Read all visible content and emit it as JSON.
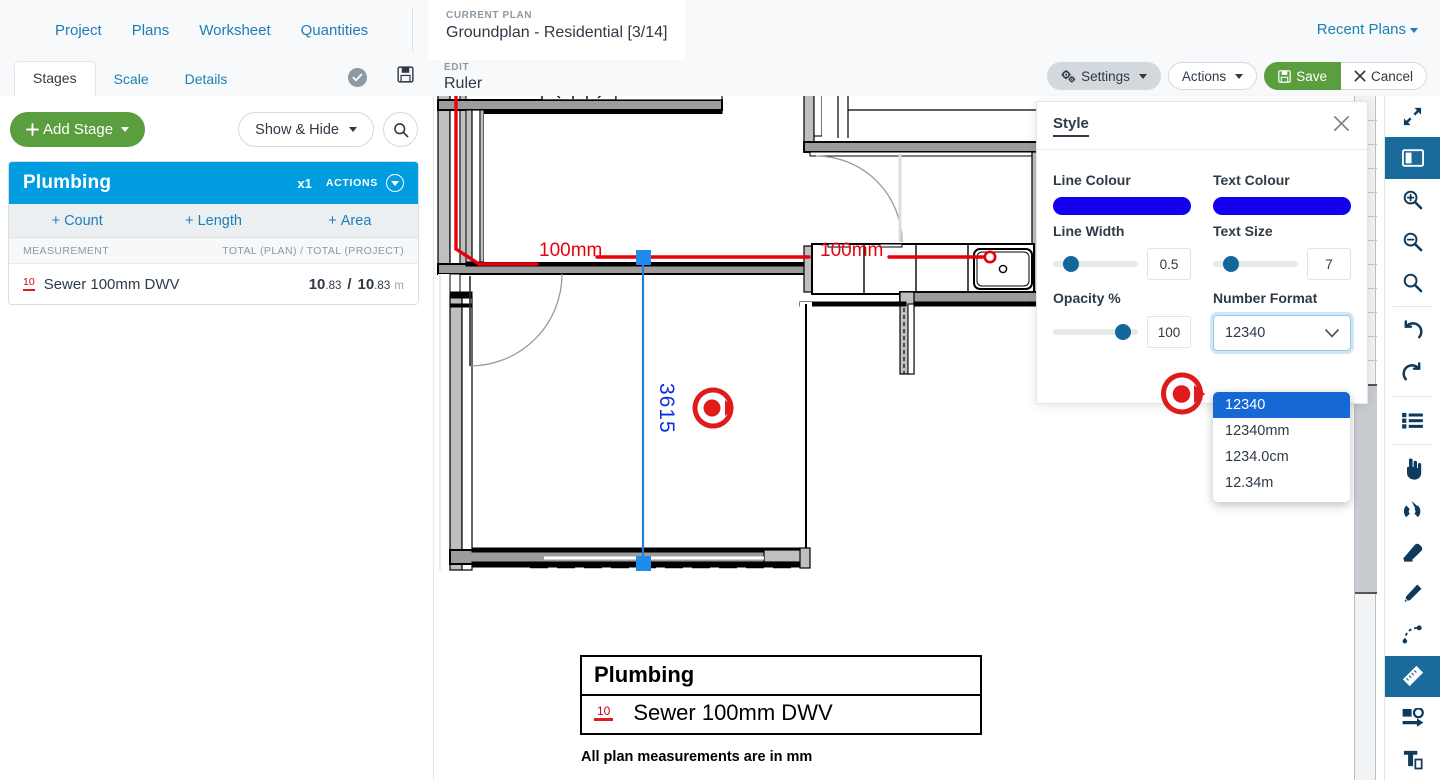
{
  "topnav": {
    "links": [
      {
        "label": "Project"
      },
      {
        "label": "Plans"
      },
      {
        "label": "Worksheet"
      },
      {
        "label": "Quantities"
      }
    ],
    "current_plan_label": "CURRENT PLAN",
    "current_plan_title": "Groundplan - Residential [3/14]",
    "recent_plans": "Recent Plans"
  },
  "subbar": {
    "tabs": [
      {
        "label": "Stages",
        "active": true
      },
      {
        "label": "Scale",
        "active": false
      },
      {
        "label": "Details",
        "active": false
      }
    ],
    "check_icon": "check-circle-icon",
    "save_icon": "floppy-disk-icon",
    "edit_label": "EDIT",
    "edit_title": "Ruler",
    "buttons": {
      "settings": "Settings",
      "actions": "Actions",
      "save": "Save",
      "cancel": "Cancel"
    }
  },
  "left_panel": {
    "add_stage": "Add Stage",
    "show_hide": "Show & Hide",
    "search_icon": "search-icon",
    "stage": {
      "name": "Plumbing",
      "multiplier": "x1",
      "actions_label": "ACTIONS",
      "add_buttons": [
        {
          "label": "Count"
        },
        {
          "label": "Length"
        },
        {
          "label": "Area"
        }
      ],
      "col_measurement": "MEASUREMENT",
      "col_totals": "TOTAL (PLAN) / TOTAL (PROJECT)",
      "rows": [
        {
          "swatch_label": "10",
          "name": "Sewer 100mm DWV",
          "total_plan_int": "10",
          "total_plan_dec": ".83",
          "separator": "/",
          "total_project_int": "10",
          "total_project_dec": ".83",
          "unit": "m"
        }
      ]
    }
  },
  "canvas": {
    "dim_labels": [
      {
        "text": "100mm"
      },
      {
        "text": "100mm"
      }
    ],
    "ruler_value": "3615",
    "legend": {
      "title": "Plumbing",
      "swatch_label": "10",
      "item": "Sewer 100mm DWV",
      "note": "All plan measurements are in mm"
    }
  },
  "style_panel": {
    "title": "Style",
    "close_icon": "close-icon",
    "line_colour_label": "Line Colour",
    "line_colour_value": "#1400ee",
    "text_colour_label": "Text Colour",
    "text_colour_value": "#1400ee",
    "line_width_label": "Line Width",
    "line_width_value": "0.5",
    "text_size_label": "Text Size",
    "text_size_value": "7",
    "opacity_label": "Opacity %",
    "opacity_value": "100",
    "number_format_label": "Number Format",
    "number_format_value": "12340",
    "number_format_options": [
      {
        "label": "12340",
        "selected": true
      },
      {
        "label": "12340mm",
        "selected": false
      },
      {
        "label": "1234.0cm",
        "selected": false
      },
      {
        "label": "12.34m",
        "selected": false
      }
    ]
  },
  "right_toolbar": {
    "tools": [
      {
        "icon": "fullscreen-expand-icon",
        "active": false
      },
      {
        "icon": "split-panel-icon",
        "active": true
      },
      {
        "icon": "zoom-in-icon",
        "active": false
      },
      {
        "icon": "zoom-out-icon",
        "active": false
      },
      {
        "icon": "zoom-fit-icon",
        "active": false
      },
      {
        "icon": "undo-icon",
        "active": false
      },
      {
        "icon": "redo-icon",
        "active": false
      },
      {
        "icon": "list-icon",
        "active": false
      },
      {
        "icon": "hand-pointer-icon",
        "active": false
      },
      {
        "icon": "magnet-snap-icon",
        "active": false
      },
      {
        "icon": "eraser-icon",
        "active": false
      },
      {
        "icon": "pencil-icon",
        "active": false
      },
      {
        "icon": "curve-icon",
        "active": false
      },
      {
        "icon": "ruler-icon",
        "active": true
      },
      {
        "icon": "shape-arrow-icon",
        "active": false
      },
      {
        "icon": "text-tool-icon",
        "active": false
      }
    ]
  },
  "colors": {
    "brand_blue": "#009ee0",
    "green": "#5a9e3f",
    "link_blue": "#1b7fb5",
    "measure_red": "#e01b24",
    "ruler_blue": "#1464d6",
    "annotation_red": "#e01b1b"
  }
}
